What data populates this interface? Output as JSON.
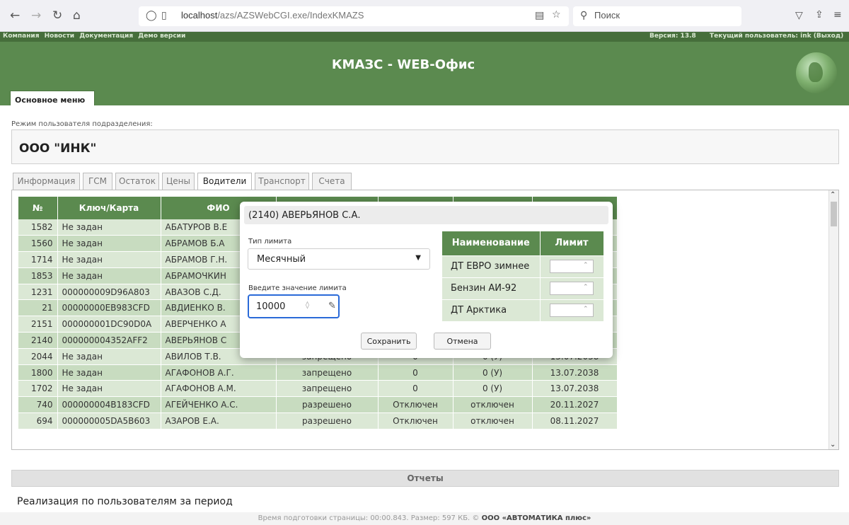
{
  "browser": {
    "url_host": "localhost",
    "url_path": "/azs/AZSWebCGI.exe/IndexKMAZS",
    "search_placeholder": "Поиск"
  },
  "top_menu": {
    "items": [
      "Компания",
      "Новости",
      "Документация",
      "Демо версии"
    ],
    "version": "Версия: 13.8",
    "user": "Текущий пользователь: ink (Выход)"
  },
  "header": {
    "title": "КМАЗС - WEB-Офис",
    "main_tab": "Основное меню"
  },
  "mode_label": "Режим пользователя подразделения:",
  "org_name": "ООО \"ИНК\"",
  "tabs": [
    "Информация",
    "ГСМ",
    "Остаток",
    "Цены",
    "Водители",
    "Транспорт",
    "Счета"
  ],
  "table": {
    "headers": [
      "№",
      "Ключ/Карта",
      "ФИО",
      "",
      "",
      "",
      ""
    ],
    "rows": [
      [
        "1582",
        "Не задан",
        "АБАТУРОВ В.Е",
        "",
        "",
        "",
        ""
      ],
      [
        "1560",
        "Не задан",
        "АБРАМОВ Б.А",
        "",
        "",
        "",
        ""
      ],
      [
        "1714",
        "Не задан",
        "АБРАМОВ Г.Н.",
        "",
        "",
        "",
        ""
      ],
      [
        "1853",
        "Не задан",
        "АБРАМОЧКИН",
        "",
        "",
        "",
        ""
      ],
      [
        "1231",
        "000000009D96A803",
        "АВАЗОВ С.Д.",
        "",
        "",
        "",
        ""
      ],
      [
        "21",
        "00000000EB983CFD",
        "АВДИЕНКО В.",
        "",
        "",
        "",
        ""
      ],
      [
        "2151",
        "000000001DC90D0A",
        "АВЕРЧЕНКО А",
        "",
        "",
        "",
        ""
      ],
      [
        "2140",
        "000000004352AFF2",
        "АВЕРЬЯНОВ С",
        "",
        "",
        "",
        ""
      ],
      [
        "2044",
        "Не задан",
        "АВИЛОВ Т.В.",
        "запрещено",
        "0",
        "0 (У)",
        "13.07.2038"
      ],
      [
        "1800",
        "Не задан",
        "АГАФОНОВ А.Г.",
        "запрещено",
        "0",
        "0 (У)",
        "13.07.2038"
      ],
      [
        "1702",
        "Не задан",
        "АГАФОНОВ А.М.",
        "запрещено",
        "0",
        "0 (У)",
        "13.07.2038"
      ],
      [
        "740",
        "000000004B183CFD",
        "АГЕЙЧЕНКО А.С.",
        "разрешено",
        "Отключен",
        "отключен",
        "20.11.2027"
      ],
      [
        "694",
        "000000005DA5B603",
        "АЗАРОВ Е.А.",
        "разрешено",
        "Отключен",
        "отключен",
        "08.11.2027"
      ]
    ]
  },
  "modal": {
    "title": "(2140) АВЕРЬЯНОВ С.А.",
    "limit_type_label": "Тип лимита",
    "limit_type_value": "Месячный",
    "limit_value_label": "Введите значение лимита",
    "limit_value": "10000",
    "limits_headers": [
      "Наименование",
      "Лимит"
    ],
    "limits_rows": [
      "ДТ ЕВРО зимнее",
      "Бензин АИ-92",
      "ДТ Арктика"
    ],
    "save_label": "Сохранить",
    "cancel_label": "Отмена"
  },
  "reports": {
    "title": "Отчеты",
    "link": "Реализация по пользователям за период"
  },
  "footer": {
    "text": "Время подготовки страницы: 00:00.843. Размер: 597 КБ. © ",
    "company": "ООО «АВТОМАТИКА плюс»"
  },
  "colors": {
    "header_green": "#5b8a4f",
    "row_light": "#dbe8d5",
    "row_dark": "#c8dcc0",
    "focus_blue": "#2a6ad8"
  }
}
